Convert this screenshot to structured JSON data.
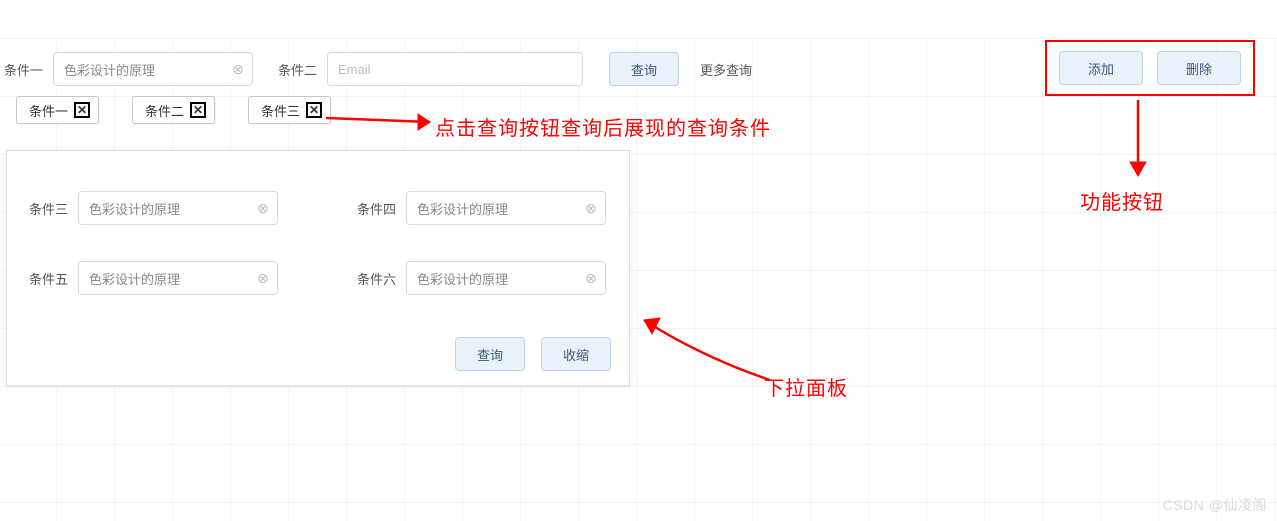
{
  "topbar": {
    "field1": {
      "label": "条件一",
      "value": "色彩设计的原理"
    },
    "field2": {
      "label": "条件二",
      "placeholder": "Email"
    },
    "query_btn": "查询",
    "more_link": "更多查询"
  },
  "tags": [
    {
      "label": "条件一"
    },
    {
      "label": "条件二"
    },
    {
      "label": "条件三"
    }
  ],
  "panel": {
    "rows": [
      {
        "label": "条件三",
        "value": "色彩设计的原理"
      },
      {
        "label": "条件四",
        "value": "色彩设计的原理"
      },
      {
        "label": "条件五",
        "value": "色彩设计的原理"
      },
      {
        "label": "条件六",
        "value": "色彩设计的原理"
      }
    ],
    "query_btn": "查询",
    "collapse_btn": "收缩"
  },
  "actions": {
    "add": "添加",
    "delete": "删除"
  },
  "annotations": {
    "query_chips": "点击查询按钮查询后展现的查询条件",
    "dropdown_panel": "下拉面板",
    "action_buttons": "功能按钮"
  },
  "watermark": "CSDN @仙凌阁",
  "icons": {
    "clear": "⊗",
    "close": "✕"
  }
}
